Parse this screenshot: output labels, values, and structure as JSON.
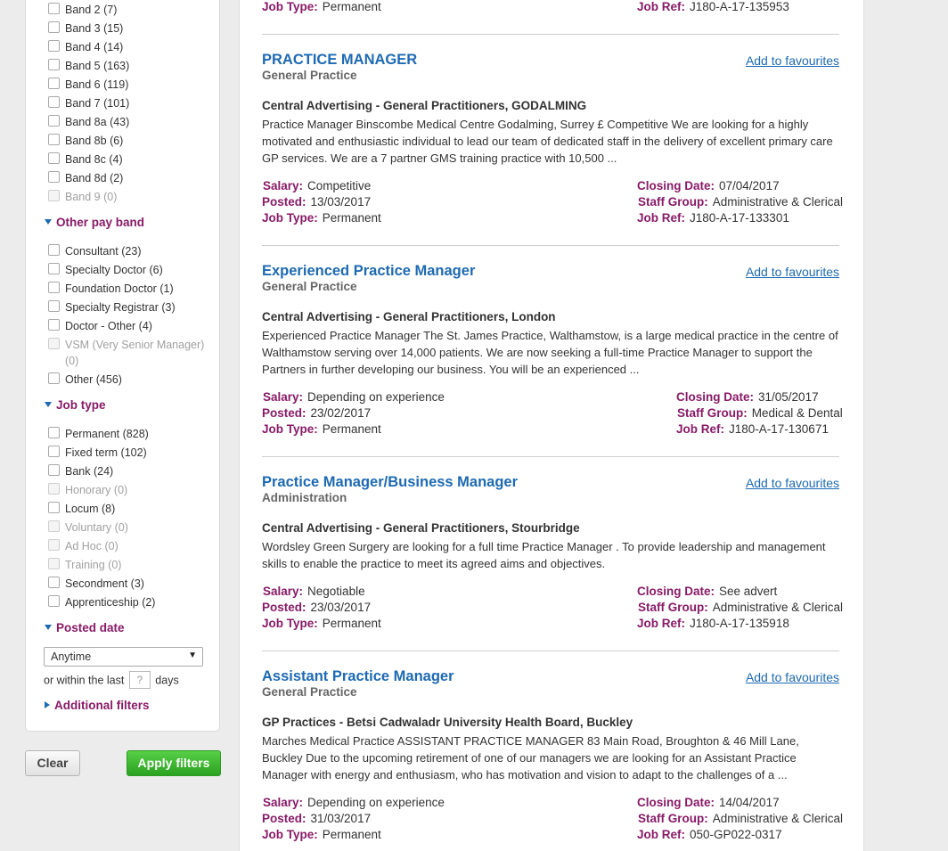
{
  "filters": {
    "pay_band_items": [
      {
        "label": "Band 2",
        "count": "(7)",
        "disabled": false
      },
      {
        "label": "Band 3",
        "count": "(15)",
        "disabled": false
      },
      {
        "label": "Band 4",
        "count": "(14)",
        "disabled": false
      },
      {
        "label": "Band 5",
        "count": "(163)",
        "disabled": false
      },
      {
        "label": "Band 6",
        "count": "(119)",
        "disabled": false
      },
      {
        "label": "Band 7",
        "count": "(101)",
        "disabled": false
      },
      {
        "label": "Band 8a",
        "count": "(43)",
        "disabled": false
      },
      {
        "label": "Band 8b",
        "count": "(6)",
        "disabled": false
      },
      {
        "label": "Band 8c",
        "count": "(4)",
        "disabled": false
      },
      {
        "label": "Band 8d",
        "count": "(2)",
        "disabled": false
      },
      {
        "label": "Band 9",
        "count": "(0)",
        "disabled": true
      }
    ],
    "other_pay_band": {
      "heading": "Other pay band",
      "items": [
        {
          "label": "Consultant",
          "count": "(23)",
          "disabled": false
        },
        {
          "label": "Specialty Doctor",
          "count": "(6)",
          "disabled": false
        },
        {
          "label": "Foundation Doctor",
          "count": "(1)",
          "disabled": false
        },
        {
          "label": "Specialty Registrar",
          "count": "(3)",
          "disabled": false
        },
        {
          "label": "Doctor - Other",
          "count": "(4)",
          "disabled": false
        },
        {
          "label": "VSM (Very Senior Manager)",
          "count": "(0)",
          "disabled": true
        },
        {
          "label": "Other",
          "count": "(456)",
          "disabled": false
        }
      ]
    },
    "job_type": {
      "heading": "Job type",
      "items": [
        {
          "label": "Permanent",
          "count": "(828)",
          "disabled": false
        },
        {
          "label": "Fixed term",
          "count": "(102)",
          "disabled": false
        },
        {
          "label": "Bank",
          "count": "(24)",
          "disabled": false
        },
        {
          "label": "Honorary",
          "count": "(0)",
          "disabled": true
        },
        {
          "label": "Locum",
          "count": "(8)",
          "disabled": false
        },
        {
          "label": "Voluntary",
          "count": "(0)",
          "disabled": true
        },
        {
          "label": "Ad Hoc",
          "count": "(0)",
          "disabled": true
        },
        {
          "label": "Training",
          "count": "(0)",
          "disabled": true
        },
        {
          "label": "Secondment",
          "count": "(3)",
          "disabled": false
        },
        {
          "label": "Apprenticeship",
          "count": "(2)",
          "disabled": false
        }
      ]
    },
    "posted_date": {
      "heading": "Posted date",
      "select_value": "Anytime",
      "within_prefix": "or within the last",
      "days_placeholder": "?",
      "within_suffix": "days"
    },
    "additional_filters": "Additional filters",
    "clear_label": "Clear",
    "apply_label": "Apply filters"
  },
  "labels": {
    "salary": "Salary:",
    "posted": "Posted:",
    "job_type": "Job Type:",
    "closing_date": "Closing Date:",
    "staff_group": "Staff Group:",
    "job_ref": "Job Ref:",
    "add_to_favourites": "Add to favourites"
  },
  "previous_job": {
    "job_type": "Permanent",
    "job_ref": "J180-A-17-135953"
  },
  "jobs": [
    {
      "title": "PRACTICE MANAGER",
      "category": "General Practice",
      "employer": "Central Advertising - General Practitioners, GODALMING",
      "description": "Practice Manager Binscombe Medical Centre Godalming, Surrey £ Competitive We are looking for a highly motivated and enthusiastic individual to lead our team of dedicated staff in the delivery of excellent primary care GP services. We are a 7 partner GMS training practice with 10,500 ...",
      "salary": "Competitive",
      "posted": "13/03/2017",
      "job_type": "Permanent",
      "closing_date": "07/04/2017",
      "staff_group": "Administrative & Clerical",
      "job_ref": "J180-A-17-133301"
    },
    {
      "title": "Experienced Practice Manager",
      "category": "General Practice",
      "employer": "Central Advertising - General Practitioners, London",
      "description": "Experienced Practice Manager The St. James Practice, Walthamstow, is a large medical practice in the centre of Walthamstow serving over 14,000 patients. We are now seeking a full-time Practice Manager to support the Partners in further developing our business. You will be an experienced ...",
      "salary": "Depending on experience",
      "posted": "23/02/2017",
      "job_type": "Permanent",
      "closing_date": "31/05/2017",
      "staff_group": "Medical & Dental",
      "job_ref": "J180-A-17-130671"
    },
    {
      "title": "Practice Manager/Business Manager",
      "category": "Administration",
      "employer": "Central Advertising - General Practitioners, Stourbridge",
      "description": "Wordsley Green Surgery are looking for a full time Practice Manager . To provide leadership and management skills to enable the practice to meet its agreed aims and objectives.",
      "salary": "Negotiable",
      "posted": "23/03/2017",
      "job_type": "Permanent",
      "closing_date": "See advert",
      "staff_group": "Administrative & Clerical",
      "job_ref": "J180-A-17-135918"
    },
    {
      "title": "Assistant Practice Manager",
      "category": "General Practice",
      "employer": "GP Practices - Betsi Cadwaladr University Health Board, Buckley",
      "description": "Marches Medical Practice ASSISTANT PRACTICE MANAGER 83 Main Road, Broughton & 46 Mill Lane, Buckley Due to the upcoming retirement of one of our managers we are looking for an Assistant Practice Manager with energy and enthusiasm, who has motivation and vision to adapt to the challenges of a ...",
      "salary": "Depending on experience",
      "posted": "31/03/2017",
      "job_type": "Permanent",
      "closing_date": "14/04/2017",
      "staff_group": "Administrative & Clerical",
      "job_ref": "050-GP022-0317"
    }
  ]
}
